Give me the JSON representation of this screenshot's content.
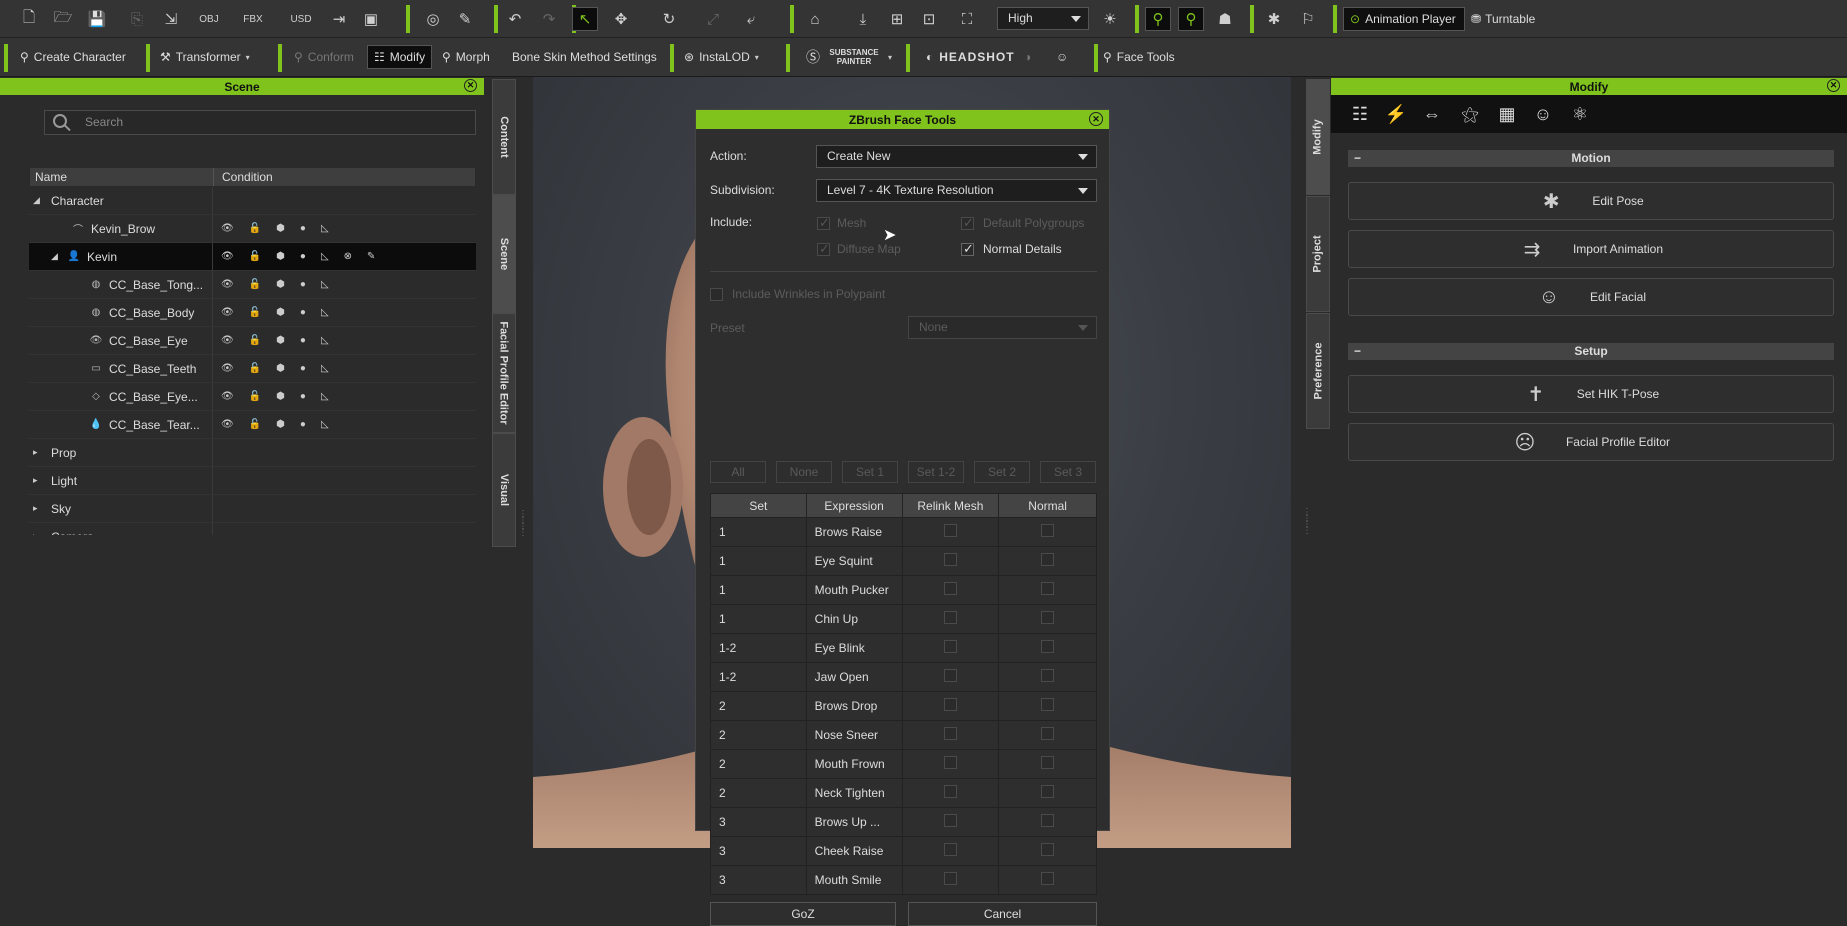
{
  "toolbar1": {
    "quality_value": "High",
    "animation_player_label": "Animation Player",
    "turntable_label": "Turntable",
    "file_icons": [
      "new-file-icon",
      "open-folder-icon",
      "save-icon",
      "export-icon",
      "import-fbx-icon",
      "obj-icon",
      "fbx-icon",
      "usd-icon",
      "exit-icon",
      "render-icon"
    ]
  },
  "toolbar2": {
    "create_character": "Create Character",
    "transformer": "Transformer",
    "conform": "Conform",
    "modify": "Modify",
    "morph": "Morph",
    "bone_skin": "Bone Skin Method Settings",
    "instalod": "InstaLOD",
    "substance": "SUBSTANCE PAINTER",
    "headshot": "HEADSHOT",
    "face_tools": "Face Tools"
  },
  "scene": {
    "title": "Scene",
    "search_placeholder": "Search",
    "col_name": "Name",
    "col_condition": "Condition",
    "rows": [
      {
        "label": "Character",
        "indent": 0,
        "expander": "open",
        "icon": ""
      },
      {
        "label": "Kevin_Brow",
        "indent": 2,
        "expander": "",
        "icon": "⌒"
      },
      {
        "label": "Kevin",
        "indent": 1,
        "expander": "open",
        "icon": "👤"
      },
      {
        "label": "CC_Base_Tong...",
        "indent": 3,
        "expander": "",
        "icon": "◍"
      },
      {
        "label": "CC_Base_Body",
        "indent": 3,
        "expander": "",
        "icon": "◍"
      },
      {
        "label": "CC_Base_Eye",
        "indent": 3,
        "expander": "",
        "icon": "👁"
      },
      {
        "label": "CC_Base_Teeth",
        "indent": 3,
        "expander": "",
        "icon": "▭"
      },
      {
        "label": "CC_Base_Eye...",
        "indent": 3,
        "expander": "",
        "icon": "◇"
      },
      {
        "label": "CC_Base_Tear...",
        "indent": 3,
        "expander": "",
        "icon": "💧"
      },
      {
        "label": "Prop",
        "indent": 0,
        "expander": "closed",
        "icon": ""
      },
      {
        "label": "Light",
        "indent": 0,
        "expander": "closed",
        "icon": ""
      },
      {
        "label": "Sky",
        "indent": 0,
        "expander": "closed",
        "icon": ""
      },
      {
        "label": "Camera",
        "indent": 0,
        "expander": "closed",
        "icon": ""
      }
    ]
  },
  "side_tabs_left": [
    "Content",
    "Scene",
    "Facial Profile Editor",
    "Visual"
  ],
  "side_tabs_right": [
    "Modify",
    "Project",
    "Preference"
  ],
  "dialog": {
    "title": "ZBrush Face Tools",
    "action_label": "Action:",
    "action_value": "Create New",
    "subdivision_label": "Subdivision:",
    "subdivision_value": "Level 7 - 4K Texture Resolution",
    "include_label": "Include:",
    "mesh": "Mesh",
    "default_polygroups": "Default Polygroups",
    "diffuse_map": "Diffuse Map",
    "normal_details": "Normal Details",
    "include_wrinkles": "Include Wrinkles in Polypaint",
    "preset_label": "Preset",
    "preset_value": "None",
    "preset_buttons": [
      "All",
      "None",
      "Set 1",
      "Set 1-2",
      "Set 2",
      "Set 3"
    ],
    "table_headers": [
      "Set",
      "Expression",
      "Relink Mesh",
      "Normal"
    ],
    "rows": [
      {
        "set": "1",
        "expression": "Brows Raise"
      },
      {
        "set": "1",
        "expression": "Eye Squint"
      },
      {
        "set": "1",
        "expression": "Mouth Pucker"
      },
      {
        "set": "1",
        "expression": "Chin Up"
      },
      {
        "set": "1-2",
        "expression": "Eye Blink"
      },
      {
        "set": "1-2",
        "expression": "Jaw Open"
      },
      {
        "set": "2",
        "expression": "Brows Drop"
      },
      {
        "set": "2",
        "expression": "Nose Sneer"
      },
      {
        "set": "2",
        "expression": "Mouth Frown"
      },
      {
        "set": "2",
        "expression": "Neck Tighten"
      },
      {
        "set": "3",
        "expression": "Brows Up ..."
      },
      {
        "set": "3",
        "expression": "Cheek Raise"
      },
      {
        "set": "3",
        "expression": "Mouth Smile"
      }
    ],
    "goz": "GoZ",
    "cancel": "Cancel"
  },
  "modify_panel": {
    "title": "Modify",
    "motion_header": "Motion",
    "setup_header": "Setup",
    "motion_buttons": [
      "Edit Pose",
      "Import Animation",
      "Edit Facial"
    ],
    "setup_buttons": [
      "Set HIK T-Pose",
      "Facial Profile Editor"
    ]
  },
  "accent_color": "#7fc31c"
}
